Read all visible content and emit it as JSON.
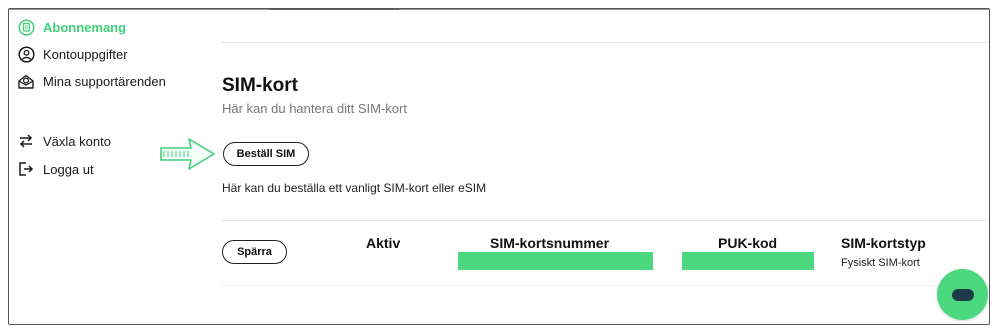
{
  "sidebar": {
    "items": [
      {
        "label": "Abonnemang",
        "icon": "subscription-icon"
      },
      {
        "label": "Kontouppgifter",
        "icon": "user-circle-icon"
      },
      {
        "label": "Mina supportärenden",
        "icon": "support-inbox-icon"
      },
      {
        "label": "Växla konto",
        "icon": "switch-arrows-icon"
      },
      {
        "label": "Logga ut",
        "icon": "logout-icon"
      }
    ]
  },
  "main": {
    "title": "SIM-kort",
    "subtitle": "Här kan du hantera ditt SIM-kort",
    "order_button": "Beställ SIM",
    "order_description": "Här kan du beställa ett vanligt SIM-kort eller eSIM",
    "sim_row": {
      "block_button": "Spärra",
      "status": "Aktiv",
      "sim_number_header": "SIM-kortsnummer",
      "puk_header": "PUK-kod",
      "sim_type_header": "SIM-kortstyp",
      "sim_type_value": "Fysiskt SIM-kort"
    }
  },
  "colors": {
    "accent_green": "#4cd87f",
    "active_text": "#3fcf7a",
    "chat_icon": "#1e3a4a"
  },
  "chat": {
    "icon": "chat-bubble-icon"
  }
}
